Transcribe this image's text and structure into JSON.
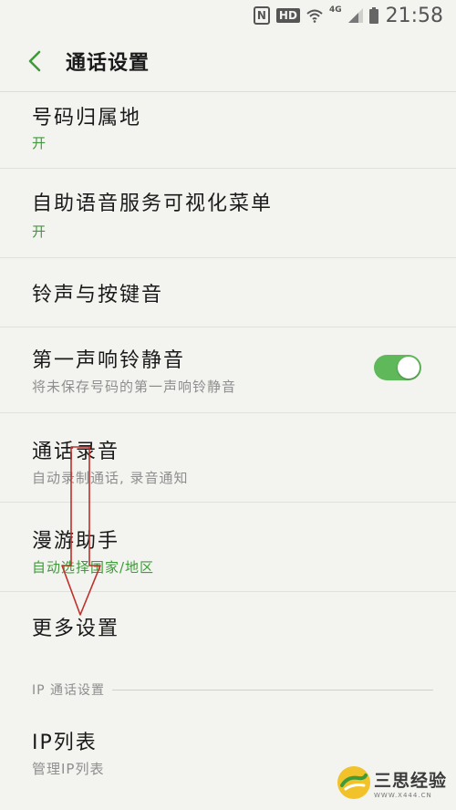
{
  "status_bar": {
    "nfc_label": "N",
    "hd_label": "HD",
    "network_label": "4G",
    "time": "21:58",
    "icons": [
      "nfc-icon",
      "hd-icon",
      "wifi-icon",
      "signal-icon",
      "battery-icon"
    ]
  },
  "header": {
    "back_icon": "chevron-left-icon",
    "title": "通话设置"
  },
  "settings": [
    {
      "title": "号码归属地",
      "subtitle": "开",
      "subtitle_color": "#3f9a3a"
    },
    {
      "title": "自助语音服务可视化菜单",
      "subtitle": "开",
      "subtitle_color": "#3f9a3a"
    },
    {
      "title": "铃声与按键音",
      "subtitle": ""
    },
    {
      "title": "第一声响铃静音",
      "subtitle": "将未保存号码的第一声响铃静音",
      "toggle_on": true
    },
    {
      "title": "通话录音",
      "subtitle": "自动录制通话, 录音通知"
    },
    {
      "title": "漫游助手",
      "subtitle": "自动选择国家/地区",
      "subtitle_color": "#3f9a3a"
    },
    {
      "title": "更多设置",
      "subtitle": ""
    }
  ],
  "section_ip": {
    "label": "IP 通话设置"
  },
  "ip_list": {
    "title": "IP列表",
    "subtitle": "管理IP列表"
  },
  "watermark": {
    "name": "三思经验",
    "url": "WWW.X444.CN"
  },
  "colors": {
    "accent": "#3f9a3a",
    "toggle_on": "#5fb95a",
    "arrow": "#c0302a"
  }
}
